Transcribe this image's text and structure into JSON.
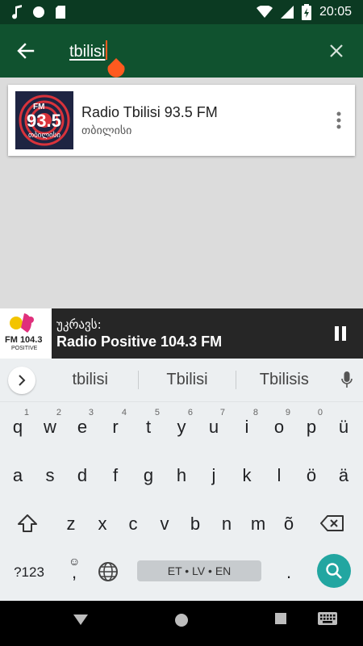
{
  "status_bar": {
    "time": "20:05"
  },
  "toolbar": {
    "search_value": "tbilisi"
  },
  "results": [
    {
      "title": "Radio Tbilisi 93.5 FM",
      "subtitle": "თბილისი",
      "logo_text": "93.5",
      "logo_fm": "FM",
      "logo_caption": "თბილისი"
    }
  ],
  "player": {
    "label": "უკრავს:",
    "station": "Radio Positive 104.3 FM",
    "logo_text": "FM 104.3",
    "logo_caption": "POSITIVE"
  },
  "keyboard": {
    "suggestions": [
      "tbilisi",
      "Tbilisi",
      "Tbilisis"
    ],
    "row1": [
      "q",
      "w",
      "e",
      "r",
      "t",
      "y",
      "u",
      "i",
      "o",
      "p",
      "ü"
    ],
    "row1_hints": [
      "1",
      "2",
      "3",
      "4",
      "5",
      "6",
      "7",
      "8",
      "9",
      "0",
      ""
    ],
    "row2": [
      "a",
      "s",
      "d",
      "f",
      "g",
      "h",
      "j",
      "k",
      "l",
      "ö",
      "ä"
    ],
    "row3": [
      "z",
      "x",
      "c",
      "v",
      "b",
      "n",
      "m",
      "õ"
    ],
    "symbols_label": "?123",
    "comma": ",",
    "period": ".",
    "space_label": "ET • LV • EN"
  },
  "colors": {
    "toolbar": "#10522f",
    "status_bar": "#0b3a22",
    "accent": "#ff5a1f",
    "search_key": "#22a6a1"
  }
}
